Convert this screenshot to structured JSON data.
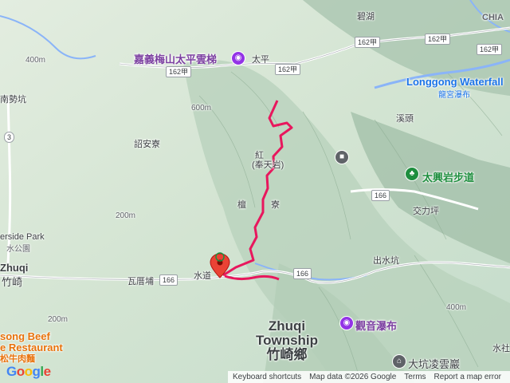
{
  "places": {
    "meishan": "嘉義梅山太平雲梯",
    "taiping": "太平",
    "bihu": "碧湖",
    "longgong_en": "Longgong Waterfall",
    "longgong_zh": "龍宮瀑布",
    "xitou": "溪頭",
    "nanshikeng": "南勢坑",
    "zhaoanliao": "詔安寮",
    "hong_a": "紅",
    "hong_b": "(奉天岩)",
    "tanzhu": "檀",
    "tanzhu2": "寮",
    "taixing": "太興岩步道",
    "jiaoliping": "交力坪",
    "chushuikeng": "出水坑",
    "riverside": "erside Park",
    "riverside2": "水公園",
    "zhuqi_en": "Zhuqi",
    "zhuqi_zh": "竹崎",
    "waliao": "瓦厝埔",
    "shuidao": "水道",
    "township_en1": "Zhuqi",
    "township_en2": "Township",
    "township_zh": "竹崎鄉",
    "guanyin": "觀音瀑布",
    "dakeng": "大坑凌雲巖",
    "beef1": "song Beef",
    "beef2": "e Restaurant",
    "beef3": "松牛肉麵",
    "shuishe": "水社",
    "chia": "CHIA",
    "elev1": "400m",
    "elev2": "200m",
    "elev3": "200m",
    "elev4": "600m",
    "elev5": "400m"
  },
  "roads": {
    "r162a_1": "162甲",
    "r162a_2": "162甲",
    "r162a_3": "162甲",
    "r162a_4": "162甲",
    "r162a_5": "162甲",
    "r166_1": "166",
    "r166_2": "166",
    "r166_3": "166",
    "r3": "3"
  },
  "footer": {
    "keyboard": "Keyboard shortcuts",
    "mapdata": "Map data ©2026 Google",
    "terms": "Terms",
    "report": "Report a map error"
  },
  "logo": "Google",
  "colors": {
    "route": "#e8175d",
    "water": "#8ab4f8",
    "terrain": "#cfe0cd",
    "poi": "#9334e6"
  }
}
